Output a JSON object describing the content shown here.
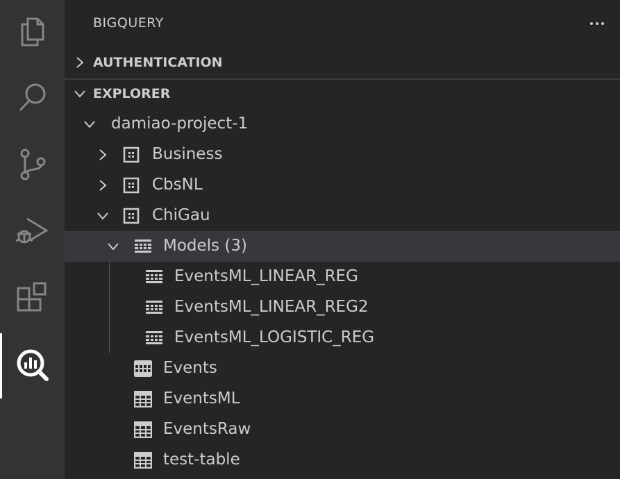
{
  "sidebar": {
    "title": "BIGQUERY",
    "more_actions_icon": "ellipsis-icon"
  },
  "activity_bar": {
    "items": [
      "explorer-icon",
      "search-icon",
      "source-control-icon",
      "run-debug-icon",
      "extensions-icon",
      "bigquery-icon"
    ],
    "active": "bigquery-icon"
  },
  "sections": {
    "authentication": {
      "label": "AUTHENTICATION",
      "expanded": false
    },
    "explorer": {
      "label": "EXPLORER",
      "expanded": true
    }
  },
  "tree": {
    "project": "damiao-project-1",
    "datasets": [
      "Business",
      "CbsNL",
      "ChiGau"
    ],
    "models_folder": "Models (3)",
    "models": [
      "EventsML_LINEAR_REG",
      "EventsML_LINEAR_REG2",
      "EventsML_LOGISTIC_REG"
    ],
    "tables": [
      "Events",
      "EventsML",
      "EventsRaw",
      "test-table"
    ]
  },
  "colors": {
    "activity_bar_bg": "#333333",
    "sidebar_bg": "#252526",
    "selected_row_bg": "#37373d",
    "text": "#cccccc",
    "active_indicator": "#ffffff"
  }
}
